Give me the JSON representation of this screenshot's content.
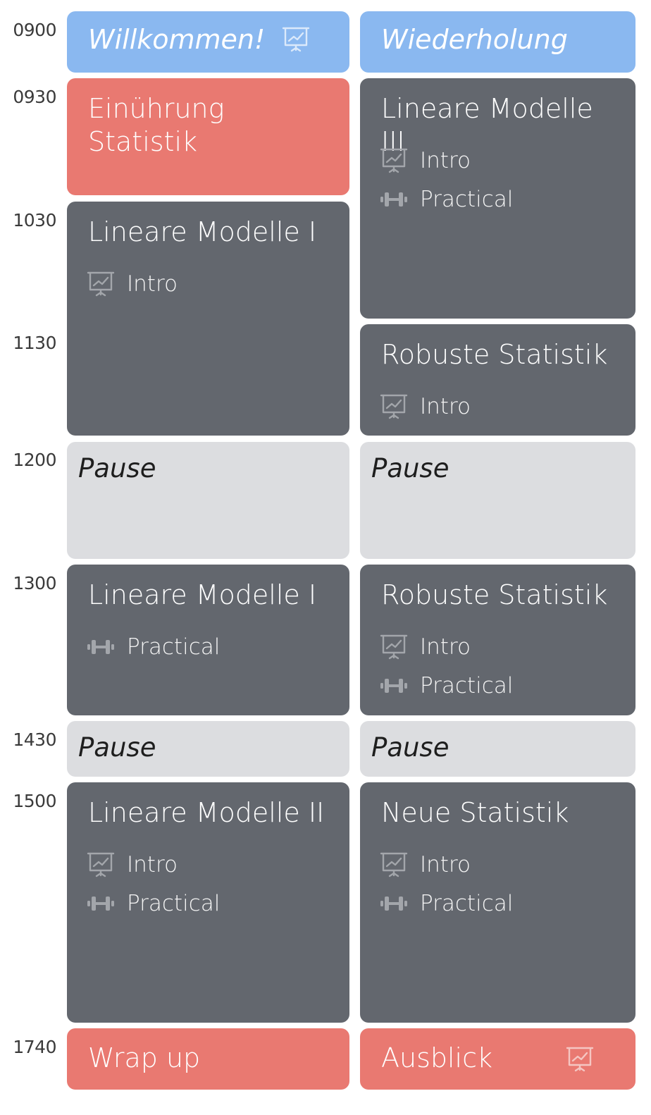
{
  "times": [
    "0900",
    "0930",
    "1030",
    "1130",
    "1200",
    "1300",
    "1430",
    "1500",
    "1740"
  ],
  "labels": {
    "intro": "Intro",
    "practical": "Practical",
    "pause": "Pause"
  },
  "icons": {
    "presentation": "presentation-board-icon",
    "practical": "dumbbell-icon"
  },
  "colors": {
    "welcome": "#8ab8f0",
    "highlight": "#e97971",
    "session": "#63676e",
    "pause": "#dcdde0"
  },
  "day1": {
    "welcome": "Willkommen!",
    "intro_stats": "Einührung\nStatistik",
    "lm1_morning": "Lineare Modelle I",
    "lm1_afternoon": "Lineare Modelle I",
    "lm2": "Lineare Modelle II",
    "wrapup": "Wrap up"
  },
  "day2": {
    "review": "Wiederholung",
    "lm3": "Lineare Modelle III",
    "robust_morning": "Robuste Statistik",
    "robust_afternoon": "Robuste Statistik",
    "new_stats": "Neue Statistik",
    "outlook": "Ausblick"
  }
}
